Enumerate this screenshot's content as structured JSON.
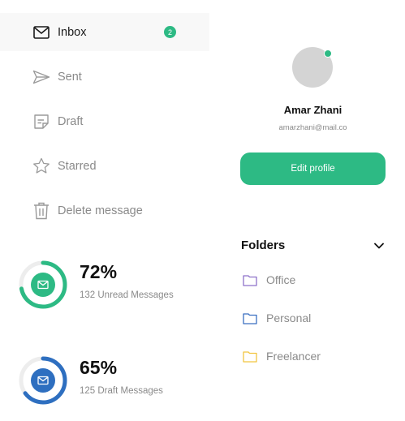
{
  "nav": {
    "items": [
      {
        "label": "Inbox",
        "icon": "mail-icon",
        "active": true,
        "badge": "2"
      },
      {
        "label": "Sent",
        "icon": "send-icon"
      },
      {
        "label": "Draft",
        "icon": "draft-icon"
      },
      {
        "label": "Starred",
        "icon": "star-icon"
      },
      {
        "label": "Delete message",
        "icon": "trash-icon"
      }
    ]
  },
  "stats": [
    {
      "percent": "72%",
      "percent_value": 72,
      "caption": "132 Unread Messages",
      "color": "#2dba84"
    },
    {
      "percent": "65%",
      "percent_value": 65,
      "caption": "125 Draft Messages",
      "color": "#2e6fc0"
    }
  ],
  "profile": {
    "name": "Amar Zhani",
    "email": "amarzhani@mail.co",
    "edit_label": "Edit profile",
    "online_color": "#2dba84"
  },
  "folders": {
    "title": "Folders",
    "items": [
      {
        "label": "Office",
        "color": "#8e72c9"
      },
      {
        "label": "Personal",
        "color": "#3a6fc1"
      },
      {
        "label": "Freelancer",
        "color": "#f2c542"
      }
    ]
  },
  "colors": {
    "accent": "#2dba84"
  }
}
